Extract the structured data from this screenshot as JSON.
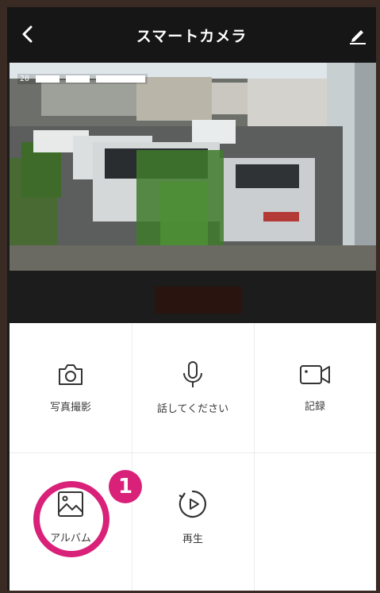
{
  "header": {
    "title": "スマートカメラ"
  },
  "video": {
    "timestamp_prefix": "20"
  },
  "controls": [
    {
      "label": "写真撮影",
      "icon": "camera-icon"
    },
    {
      "label": "話してください",
      "icon": "microphone-icon"
    },
    {
      "label": "記録",
      "icon": "video-record-icon"
    },
    {
      "label": "アルバム",
      "icon": "album-icon"
    },
    {
      "label": "再生",
      "icon": "playback-icon"
    }
  ],
  "annotation": {
    "badge": "1",
    "color": "#d9217a"
  }
}
